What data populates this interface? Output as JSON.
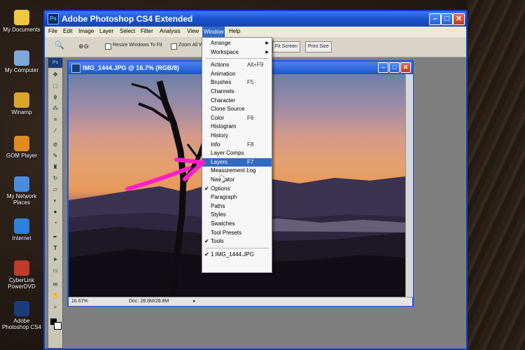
{
  "desktop": {
    "icons": [
      {
        "label": "My Documents",
        "color": "#f0c840"
      },
      {
        "label": "My Computer",
        "color": "#7fa7d8"
      },
      {
        "label": "Winamp",
        "color": "#d9a62a"
      },
      {
        "label": "GOM Player",
        "color": "#e08a20"
      },
      {
        "label": "My Network Places",
        "color": "#4a8be0"
      },
      {
        "label": "Internet",
        "color": "#2d7fe0"
      },
      {
        "label": "CyberLink PowerDVD",
        "color": "#c23a2a"
      },
      {
        "label": "Adobe Photoshop CS4",
        "color": "#1a3c7a"
      }
    ]
  },
  "app": {
    "title": "Adobe Photoshop CS4 Extended",
    "logo": "Ps",
    "menus": [
      "File",
      "Edit",
      "Image",
      "Layer",
      "Select",
      "Filter",
      "Analysis",
      "View",
      "Window",
      "Help"
    ],
    "active_menu": "Window"
  },
  "options": {
    "zoom_icon": "🔍",
    "resize_label": "Resize Windows To Fit",
    "zoom_all_label": "Zoom All W",
    "fit_screen": "Fit Screen",
    "print_size": "Print Size"
  },
  "toolbox": {
    "badge": "Ps"
  },
  "document": {
    "title": "IMG_1444.JPG @ 16.7% (RGB/8)",
    "zoom": "16.67%",
    "doc_size": "Doc: 28.8M/28.8M"
  },
  "window_menu": {
    "items": [
      {
        "label": "Arrange",
        "submenu": true
      },
      {
        "label": "Workspace",
        "submenu": true
      },
      {
        "separator": true
      },
      {
        "label": "Actions",
        "shortcut": "Alt+F9"
      },
      {
        "label": "Animation"
      },
      {
        "label": "Brushes",
        "shortcut": "F5"
      },
      {
        "label": "Channels"
      },
      {
        "label": "Character"
      },
      {
        "label": "Clone Source"
      },
      {
        "label": "Color",
        "shortcut": "F6"
      },
      {
        "label": "Histogram"
      },
      {
        "label": "History"
      },
      {
        "label": "Info",
        "shortcut": "F8"
      },
      {
        "label": "Layer Comps"
      },
      {
        "label": "Layers",
        "shortcut": "F7",
        "highlighted": true
      },
      {
        "label": "Measurement Log"
      },
      {
        "label": "Navigator"
      },
      {
        "label": "Options",
        "checked": true
      },
      {
        "label": "Paragraph"
      },
      {
        "label": "Paths"
      },
      {
        "label": "Styles"
      },
      {
        "label": "Swatches"
      },
      {
        "label": "Tool Presets"
      },
      {
        "label": "Tools",
        "checked": true
      },
      {
        "separator": true
      },
      {
        "label": "1 IMG_1444.JPG",
        "checked": true
      }
    ]
  },
  "colors": {
    "annotation_arrow": "#ff1fc8",
    "menu_highlight": "#316ac5"
  }
}
